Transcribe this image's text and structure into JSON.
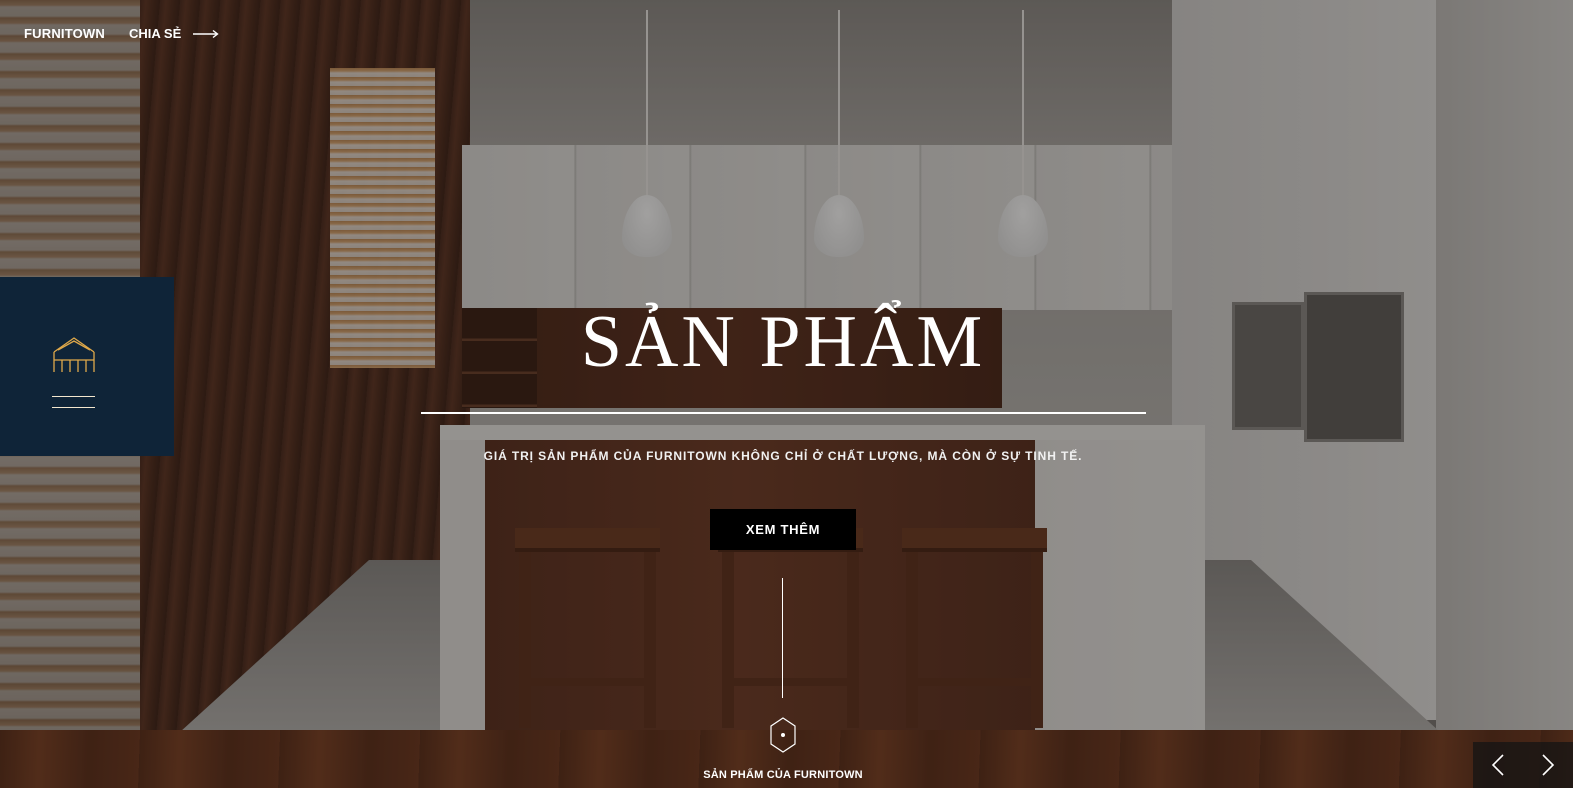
{
  "header": {
    "brand": "FURNITOWN",
    "share_label": "CHIA SẺ",
    "share_icon": "long-arrow-right-icon"
  },
  "side_panel": {
    "background_color": "#0f2438",
    "accent_color": "#e0a94a",
    "icon": "house-outline-icon",
    "menu_icon": "menu-lines-icon"
  },
  "hero": {
    "title": "SẢN PHẨM",
    "subtitle": "GIÁ TRỊ SẢN PHẨM CỦA FURNITOWN KHÔNG CHỈ Ở CHẤT LƯỢNG, MÀ CÒN Ở SỰ TINH TẾ.",
    "cta_label": "XEM THÊM"
  },
  "footer": {
    "caption": "SẢN PHẨM CỦA FURNITOWN",
    "scroll_icon": "hexagon-dot-icon"
  },
  "slider": {
    "prev_icon": "chevron-left-icon",
    "next_icon": "chevron-right-icon"
  }
}
